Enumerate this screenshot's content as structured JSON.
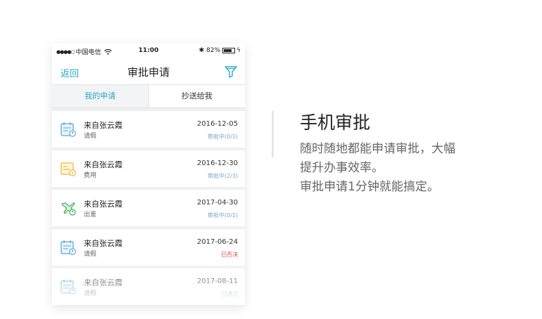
{
  "status_bar": {
    "carrier": "中国电信",
    "time": "11:00",
    "battery_text": "82%",
    "battery_level": 0.82
  },
  "navbar": {
    "back": "返回",
    "title": "审批申请",
    "filter_icon": "funnel-icon",
    "accent_color": "#29a8c7"
  },
  "tabs": [
    {
      "label": "我的申请",
      "active": true
    },
    {
      "label": "抄送给我",
      "active": false
    }
  ],
  "requests": [
    {
      "from": "来自张云霞",
      "type": "请假",
      "date": "2016-12-05",
      "status": "审批中(0/1)",
      "state": "pending",
      "icon": "leave-calendar-icon"
    },
    {
      "from": "来自张云霞",
      "type": "费用",
      "date": "2016-12-30",
      "status": "审批中(2/3)",
      "state": "pending",
      "icon": "expense-receipt-icon"
    },
    {
      "from": "来自张云霞",
      "type": "出差",
      "date": "2017-04-30",
      "status": "审批中(0/1)",
      "state": "pending",
      "icon": "business-trip-plane-icon"
    },
    {
      "from": "来自张云霞",
      "type": "请假",
      "date": "2017-06-24",
      "status": "已否决",
      "state": "rejected",
      "icon": "leave-calendar-icon"
    },
    {
      "from": "来自张云霞",
      "type": "请假",
      "date": "2017-08-11",
      "status": "已通过",
      "state": "approved",
      "icon": "leave-calendar-icon"
    }
  ],
  "status_colors": {
    "pending": "#7aa7c7",
    "rejected": "#e0453a",
    "approved": "#6cc08a"
  },
  "feature": {
    "title": "手机审批",
    "lines": [
      "随时随地都能申请审批，大幅",
      "提升办事效率。",
      "审批申请1分钟就能搞定。"
    ]
  }
}
